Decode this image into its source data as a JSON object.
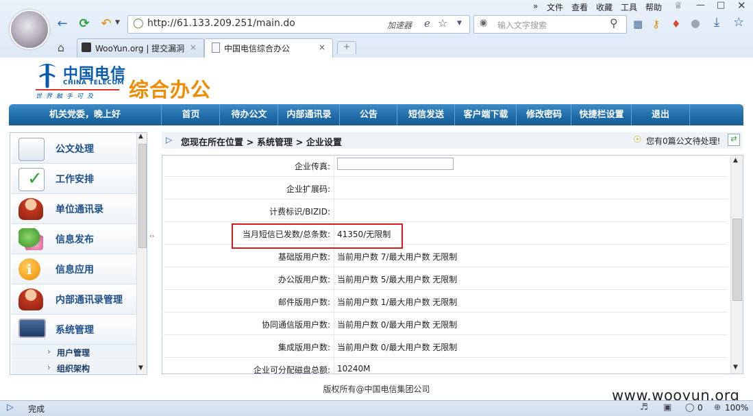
{
  "browser": {
    "menu": [
      "文件",
      "查看",
      "收藏",
      "工具",
      "帮助"
    ],
    "more_glyph": "»",
    "address": "http://61.133.209.251/main.do",
    "accelerator_label": "加速器",
    "search_placeholder": "输入文字搜索",
    "tabs": [
      {
        "label": "WooYun.org | 提交漏洞",
        "active": false
      },
      {
        "label": "中国电信综合办公",
        "active": true
      }
    ],
    "new_tab_glyph": "+",
    "close_glyph": "×",
    "status_text": "完成",
    "status_counter": "0",
    "zoom": "100%"
  },
  "header": {
    "logo_cn": "中国电信",
    "logo_en": "CHINA TELECOM",
    "logo_slogan": "世界触手可及",
    "product_title": "综合办公"
  },
  "nav": {
    "greeting": "机关党委，晚上好",
    "items": [
      "首页",
      "待办公文",
      "内部通讯录",
      "公告",
      "短信发送",
      "客户端下载",
      "修改密码",
      "快捷栏设置",
      "退出"
    ]
  },
  "sidebar": {
    "items": [
      {
        "label": "公文处理",
        "icon": "document-list-icon"
      },
      {
        "label": "工作安排",
        "icon": "checklist-icon"
      },
      {
        "label": "单位通讯录",
        "icon": "person-icon"
      },
      {
        "label": "信息发布",
        "icon": "chat-bubbles-icon"
      },
      {
        "label": "信息应用",
        "icon": "info-icon"
      },
      {
        "label": "内部通讯录管理",
        "icon": "person-icon"
      },
      {
        "label": "系统管理",
        "icon": "monitor-icon"
      }
    ],
    "sub_items": [
      "用户管理",
      "组织架构"
    ],
    "sub_arrow": "›"
  },
  "breadcrumb": {
    "text": "您现在所在位置  > 系统管理  > 企业设置"
  },
  "notice": "您有0篇公文待处理!",
  "form_rows": [
    {
      "label": "企业传真:",
      "value": "",
      "has_input": true
    },
    {
      "label": "企业扩展码:",
      "value": ""
    },
    {
      "label": "计费标识/BIZID:",
      "value": ""
    },
    {
      "label": "当月短信已发数/总条数:",
      "value": "41350/无限制"
    },
    {
      "label": "基础版用户数:",
      "value": "当前用户数  7/最大用户数  无限制"
    },
    {
      "label": "办公版用户数:",
      "value": "当前用户数  5/最大用户数  无限制"
    },
    {
      "label": "邮件版用户数:",
      "value": "当前用户数  1/最大用户数  无限制"
    },
    {
      "label": "协同通信版用户数:",
      "value": "当前用户数  0/最大用户数  无限制"
    },
    {
      "label": "集成版用户数:",
      "value": "当前用户数  0/最大用户数  无限制"
    },
    {
      "label": "企业可分配磁盘总额:",
      "value": "10240M"
    }
  ],
  "footer": {
    "copyright": "版权所有@中国电信集团公司",
    "watermark": "www.wooyun.org"
  },
  "colors": {
    "nav_blue": "#1e6aa6",
    "title_orange": "#f08a00",
    "highlight_red": "#d61a1a"
  }
}
